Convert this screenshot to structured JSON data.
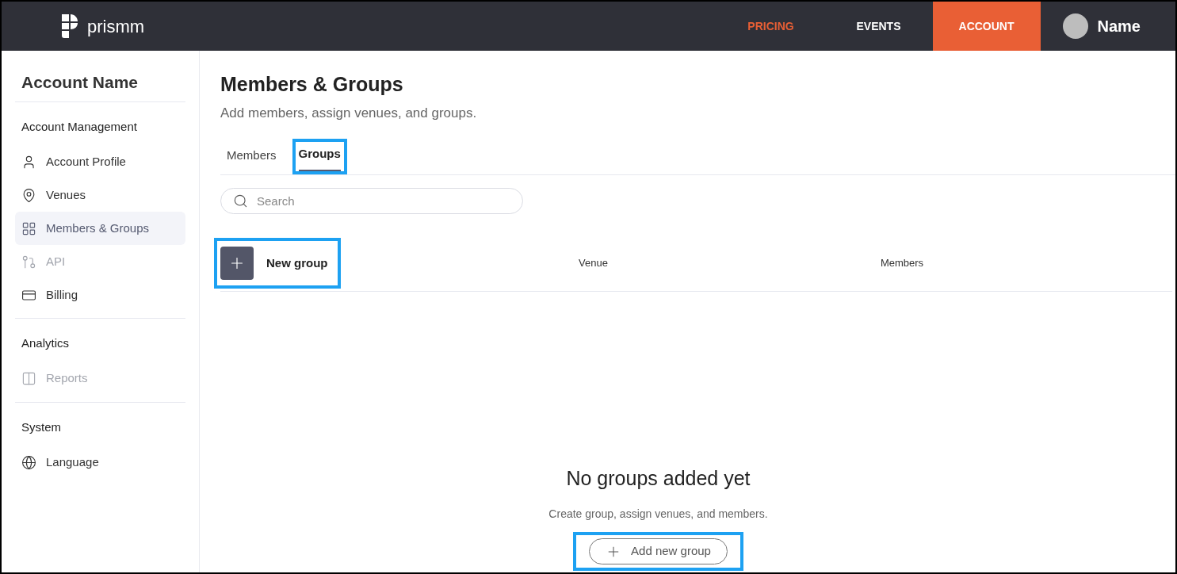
{
  "topbar": {
    "logo": "prismm",
    "nav": [
      {
        "label": "PRICING",
        "kind": "link",
        "selected": false
      },
      {
        "label": "EVENTS",
        "kind": "plain",
        "selected": false
      },
      {
        "label": "ACCOUNT",
        "kind": "plain",
        "selected": true
      }
    ],
    "user": "Name"
  },
  "sidebar": {
    "title": "Account Name",
    "sections": [
      {
        "heading": "Account Management",
        "items": [
          {
            "label": "Account Profile",
            "kind": "user",
            "selected": false,
            "disabled": false
          },
          {
            "label": "Venues",
            "kind": "pin",
            "selected": false,
            "disabled": false
          },
          {
            "label": "Members & Groups",
            "kind": "grid",
            "selected": true,
            "disabled": false
          },
          {
            "label": "API",
            "kind": "api",
            "selected": false,
            "disabled": true
          },
          {
            "label": "Billing",
            "kind": "card",
            "selected": false,
            "disabled": false
          }
        ]
      },
      {
        "heading": "Analytics",
        "items": [
          {
            "label": "Reports",
            "kind": "report",
            "selected": false,
            "disabled": true
          }
        ]
      },
      {
        "heading": "System",
        "items": [
          {
            "label": "Language",
            "kind": "globe",
            "selected": false,
            "disabled": false
          }
        ]
      }
    ]
  },
  "page": {
    "title": "Members & Groups",
    "subtitle": "Add members, assign venues, and groups.",
    "tabs": [
      {
        "label": "Members",
        "selected": false,
        "highlighted": false
      },
      {
        "label": "Groups",
        "selected": true,
        "highlighted": true
      }
    ],
    "search": {
      "placeholder": "Search"
    },
    "table": {
      "new_button": {
        "label": "New group",
        "highlighted": true
      },
      "columns": [
        "Venue",
        "Members"
      ]
    },
    "empty": {
      "title": "No groups added yet",
      "text": "Create group, assign venues, and members.",
      "button": {
        "label": "Add new group",
        "highlighted": true
      }
    }
  }
}
